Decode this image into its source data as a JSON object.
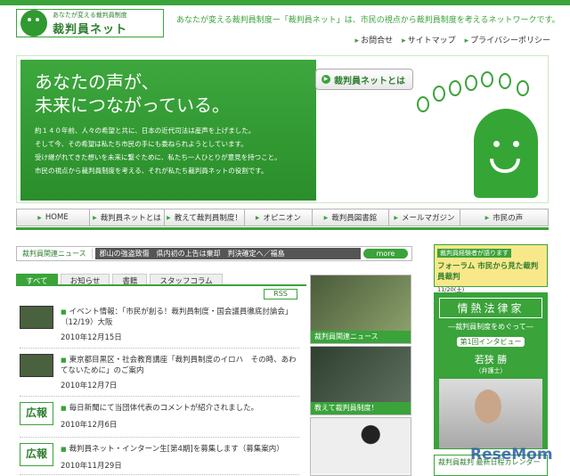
{
  "header": {
    "logo_sub": "あなたが変える裁判員制度",
    "logo_name": "裁判員ネット",
    "tagline": "あなたが変える裁判員制度ー「裁判員ネット」は、市民の視点から裁判員制度を考えるネットワークです。",
    "links": [
      "お問合せ",
      "サイトマップ",
      "プライバシーポリシー"
    ]
  },
  "hero": {
    "title_line1": "あなたの声が、",
    "title_line2": "未来につながっている。",
    "body": [
      "約１４０年前、人々の希望と共に、日本の近代司法は産声を上げました。",
      "そして今、その希望は私たち市民の手にも委ねられようとしています。",
      "受け継がれてきた想いを未来に繋ぐために、私たち一人ひとりが意見を持つこと。",
      "市民の視点から裁判員制度を考える、それが私たち裁判員ネットの役割です。"
    ],
    "button": "裁判員ネットとは"
  },
  "nav": [
    "HOME",
    "裁判員ネットとは",
    "教えて裁判員制度！",
    "オピニオン",
    "裁判員図書館",
    "メールマガジン",
    "市民の声"
  ],
  "news": {
    "label": "裁判員関連ニュース",
    "ticker": "郡山の強盗致傷　県内初の上告は棄却　判決確定へ／福島",
    "more": "more"
  },
  "tabs": [
    "すべて",
    "お知らせ",
    "書籍",
    "スタッフコラム"
  ],
  "rss": "RSS",
  "items": [
    {
      "title": "イベント情報：「市民が創る！裁判員制度・国会議員徹底討論会」（12/19）大阪",
      "date": "2010年12月15日"
    },
    {
      "title": "東京都目黒区・社会教育講座「裁判員制度のイロハ　その時、あわてないために」のご案内",
      "date": "2010年12月7日"
    },
    {
      "title": "毎日新聞にて当団体代表のコメントが紹介されました。",
      "date": "2010年12月6日",
      "badge": "広報"
    },
    {
      "title": "裁判員ネット・インターン生[第4期]を募集します（募集案内）",
      "date": "2010年11月29日",
      "badge": "広報"
    }
  ],
  "features": [
    {
      "caption": "裁判員関連ニュース"
    },
    {
      "caption": "教えて裁判員制度！"
    }
  ],
  "side1": {
    "label": "裁判員経験者が語ります",
    "title": "フォーラム 市民から見た裁判員裁判",
    "date": "11/20(土)"
  },
  "side2": {
    "heading": "情熱法律家",
    "sub": "―裁判員制度をめぐって―",
    "interview": "第1回インタビュー",
    "name": "若狭 勝",
    "role": "（弁護士）"
  },
  "side3": {
    "label": "裁判員裁判 最新日程カレンダー"
  },
  "watermark": "ReseMom"
}
